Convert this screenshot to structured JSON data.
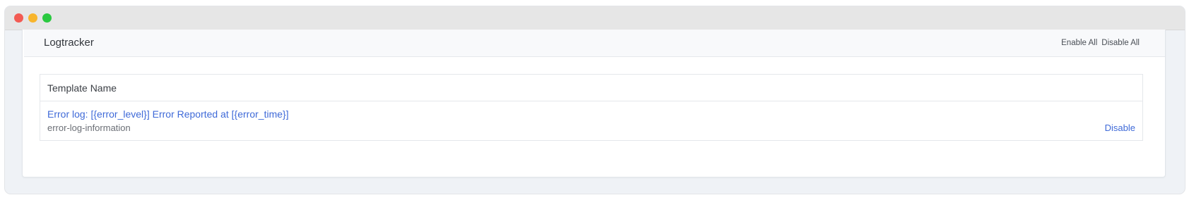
{
  "window": {
    "controls": [
      "close",
      "minimize",
      "maximize"
    ]
  },
  "panel": {
    "title": "Logtracker",
    "enable_all_label": "Enable All",
    "disable_all_label": "Disable All"
  },
  "table": {
    "column_header": "Template Name",
    "rows": [
      {
        "title": "Error log: [{error_level}] Error Reported at [{error_time}]",
        "slug": "error-log-information",
        "action": "Disable"
      }
    ]
  },
  "colors": {
    "link": "#3f6ad8",
    "close": "#f35b53",
    "minimize": "#f8b52c",
    "maximize": "#2ac940"
  }
}
